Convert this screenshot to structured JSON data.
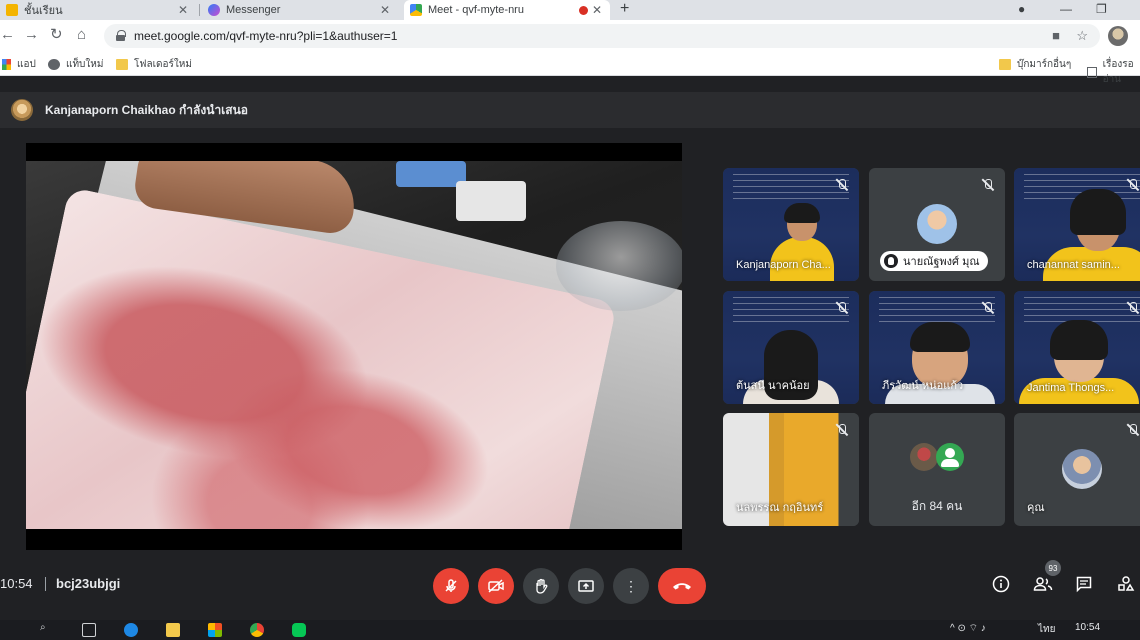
{
  "browser": {
    "tabs": [
      {
        "label": "ชั้นเรียน"
      },
      {
        "label": "Messenger"
      },
      {
        "label": "Meet - qvf-myte-nru"
      }
    ],
    "url": "meet.google.com/qvf-myte-nru?pli=1&authuser=1",
    "bookmarks": [
      {
        "label": "แอป"
      },
      {
        "label": "แท็บใหม่"
      },
      {
        "label": "โฟลเดอร์ใหม่"
      },
      {
        "label": "บุ๊กมาร์กอื่นๆ"
      },
      {
        "label": "เรื่องรออ่าน"
      }
    ]
  },
  "meet": {
    "presenter_banner": "Kanjanaporn Chaikhao กำลังนำเสนอ",
    "participants": [
      {
        "name": "Kanjanaporn Cha..."
      },
      {
        "name": "นายณัฐพงศ์ มุณ"
      },
      {
        "name": "chanannat samin..."
      },
      {
        "name": "ต้นสนี นาคน้อย"
      },
      {
        "name": "ภีรวัฒน์ หน่อแก้ว"
      },
      {
        "name": "Jantima Thongs..."
      },
      {
        "name": "นลพรรณ กฤอินทร์"
      },
      {
        "name": "คุณ"
      }
    ],
    "more_participants": "อีก 84 คน",
    "time": "10:54",
    "meeting_code": "bcj23ubjgi",
    "people_count": "93",
    "icons": {
      "mic": "mic-off-icon",
      "camera": "camera-off-icon",
      "hand": "raise-hand-icon",
      "present": "present-screen-icon",
      "more": "more-options-icon",
      "hangup": "hang-up-icon",
      "info": "info-icon",
      "people": "people-icon",
      "chat": "chat-icon",
      "activities": "activities-icon"
    },
    "colors": {
      "danger": "#ea4335",
      "surface": "#202124",
      "tile": "#3c4043"
    }
  },
  "taskbar": {
    "clock": "10:54",
    "language": "ไทย"
  }
}
